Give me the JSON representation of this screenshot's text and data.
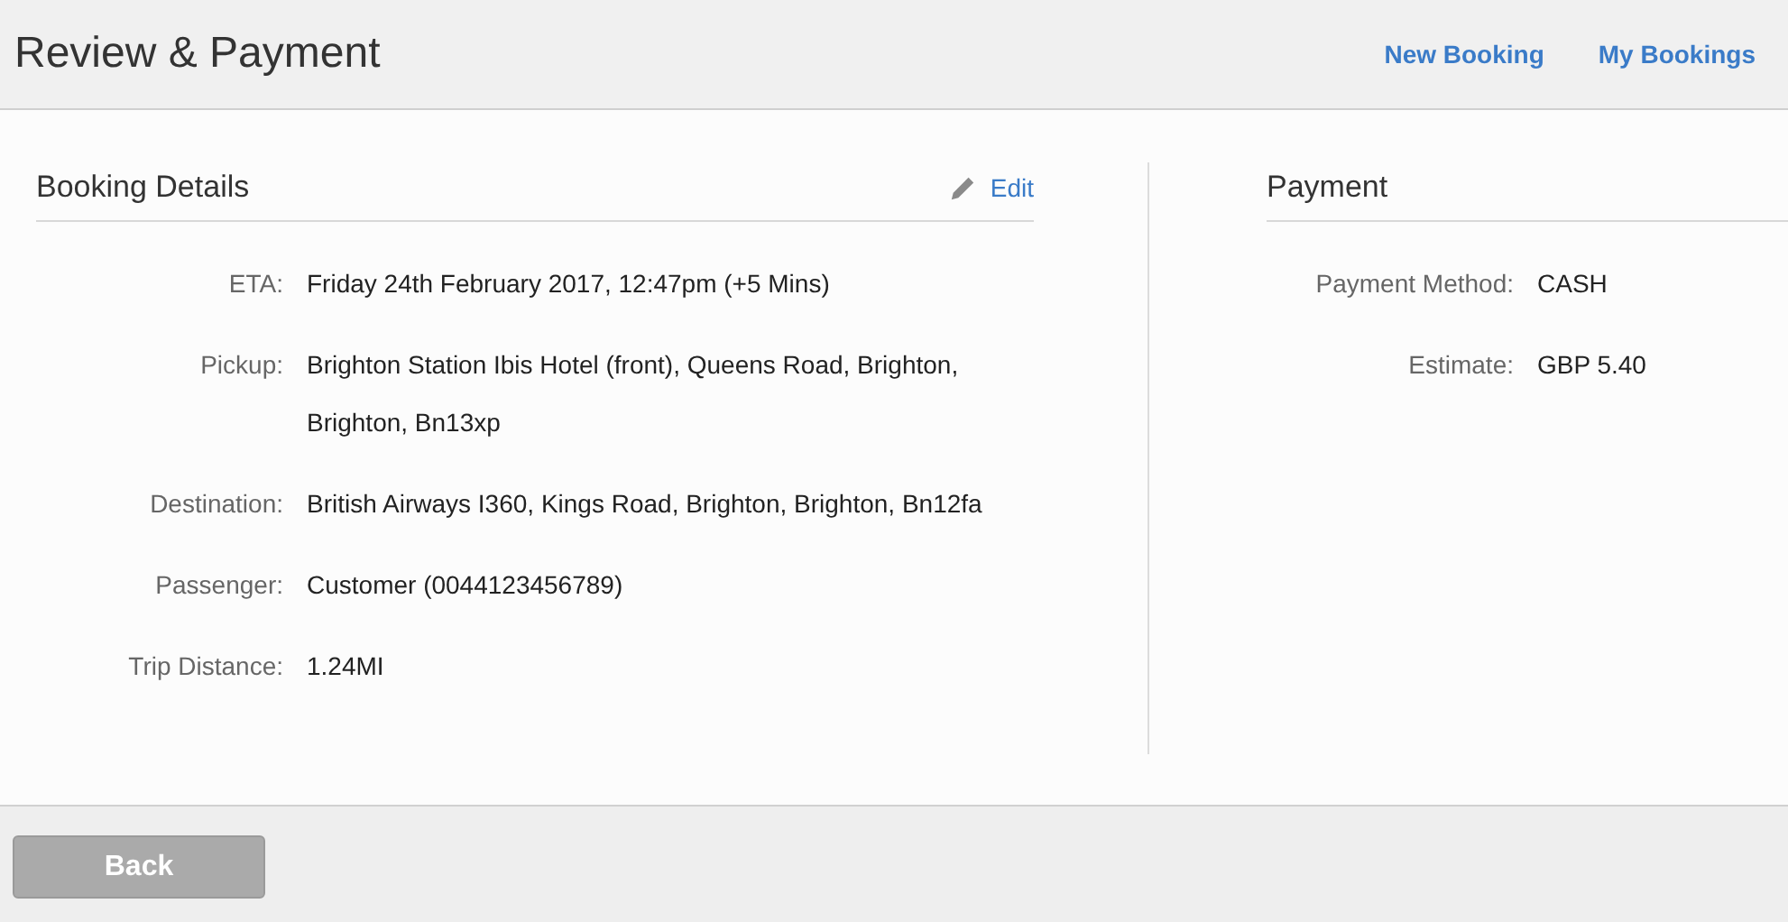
{
  "header": {
    "title": "Review & Payment",
    "links": [
      {
        "label": "New Booking"
      },
      {
        "label": "My Bookings"
      }
    ]
  },
  "booking_details": {
    "title": "Booking Details",
    "edit_link": "Edit",
    "fields": [
      {
        "label": "ETA:",
        "value": "Friday 24th February 2017, 12:47pm (+5 Mins)"
      },
      {
        "label": "Pickup:",
        "value": "Brighton Station Ibis Hotel (front), Queens Road, Brighton, Brighton, Bn13xp"
      },
      {
        "label": "Destination:",
        "value": "British Airways I360, Kings Road, Brighton, Brighton, Bn12fa"
      },
      {
        "label": "Passenger:",
        "value": "Customer (0044123456789)"
      },
      {
        "label": "Trip Distance:",
        "value": "1.24MI"
      }
    ]
  },
  "payment": {
    "title": "Payment",
    "fields": [
      {
        "label": "Payment Method:",
        "value": "CASH"
      },
      {
        "label": "Estimate:",
        "value": "GBP 5.40"
      }
    ]
  },
  "footer": {
    "back_button": {
      "label": "Back",
      "disabled": true
    }
  }
}
